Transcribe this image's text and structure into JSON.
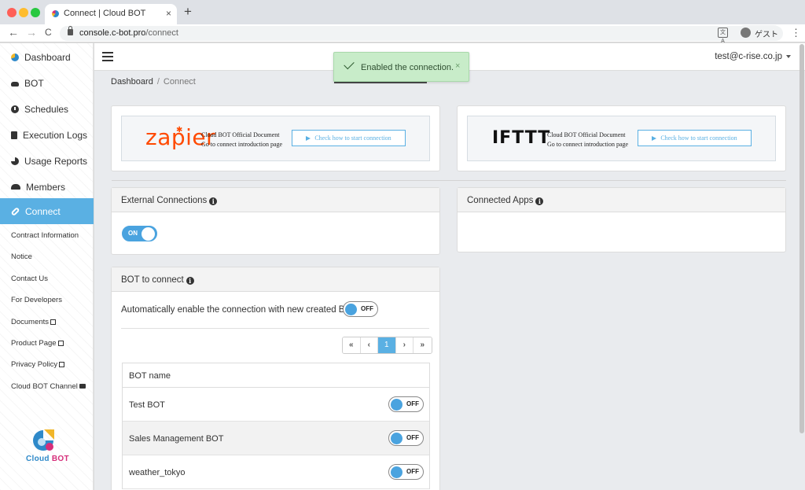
{
  "browser": {
    "tab_title": "Connect | Cloud BOT",
    "tab_close": "×",
    "new_tab": "+",
    "back": "←",
    "forward": "→",
    "reload": "C",
    "url_host": "console.c-bot.pro",
    "url_path": "/connect",
    "translate": "文A",
    "profile_label": "ゲスト",
    "menu": "⋮"
  },
  "sidebar": {
    "items": [
      {
        "label": "Dashboard",
        "icon": "dashboard-icon"
      },
      {
        "label": "BOT",
        "icon": "bot-icon"
      },
      {
        "label": "Schedules",
        "icon": "clock-icon"
      },
      {
        "label": "Execution Logs",
        "icon": "file-icon"
      },
      {
        "label": "Usage Reports",
        "icon": "pie-chart-icon"
      },
      {
        "label": "Members",
        "icon": "users-icon"
      },
      {
        "label": "Connect",
        "icon": "link-icon",
        "active": true
      }
    ],
    "links": [
      {
        "label": "Contract Information"
      },
      {
        "label": "Notice"
      },
      {
        "label": "Contact Us"
      },
      {
        "label": "For Developers"
      },
      {
        "label": "Documents",
        "icon": "external-link-icon"
      },
      {
        "label": "Product Page",
        "icon": "external-link-icon"
      },
      {
        "label": "Privacy Policy",
        "icon": "external-link-icon"
      },
      {
        "label": "Cloud BOT Channel",
        "icon": "youtube-icon"
      }
    ],
    "logo_text_1": "Cloud ",
    "logo_text_2": "BOT"
  },
  "header": {
    "user_email": "test@c-rise.co.jp"
  },
  "breadcrumb": {
    "root": "Dashboard",
    "separator": "/",
    "current": "Connect"
  },
  "toast": {
    "message": "Enabled the connection.",
    "close": "×"
  },
  "banners": {
    "zapier": {
      "logo": "zapier",
      "line1": "Cloud BOT Official Document",
      "line2": "Go to connect introduction page",
      "button": "Check how to start connection"
    },
    "ifttt": {
      "logo": "IFTTT",
      "line1": "Cloud BOT Official Document",
      "line2": "Go to connect introduction page",
      "button": "Check how to start connection"
    }
  },
  "external_connections": {
    "title": "External Connections",
    "toggle_label": "ON",
    "enabled": true
  },
  "connected_apps": {
    "title": "Connected Apps"
  },
  "bot_to_connect": {
    "title": "BOT to connect",
    "auto_enable_text": "Automatically enable the connection with new created BOT.",
    "auto_enable_toggle": "OFF",
    "pager": [
      "«",
      "‹",
      "1",
      "›",
      "»"
    ],
    "column_header": "BOT name",
    "rows": [
      {
        "name": "Test BOT",
        "toggle": "OFF"
      },
      {
        "name": "Sales Management BOT",
        "toggle": "OFF"
      },
      {
        "name": "weather_tokyo",
        "toggle": "OFF"
      }
    ]
  },
  "colors": {
    "accent": "#5ab0e3",
    "toggle_blue": "#4aa3df",
    "zapier_orange": "#ff4a00",
    "toast_green": "#c8ecc9"
  }
}
